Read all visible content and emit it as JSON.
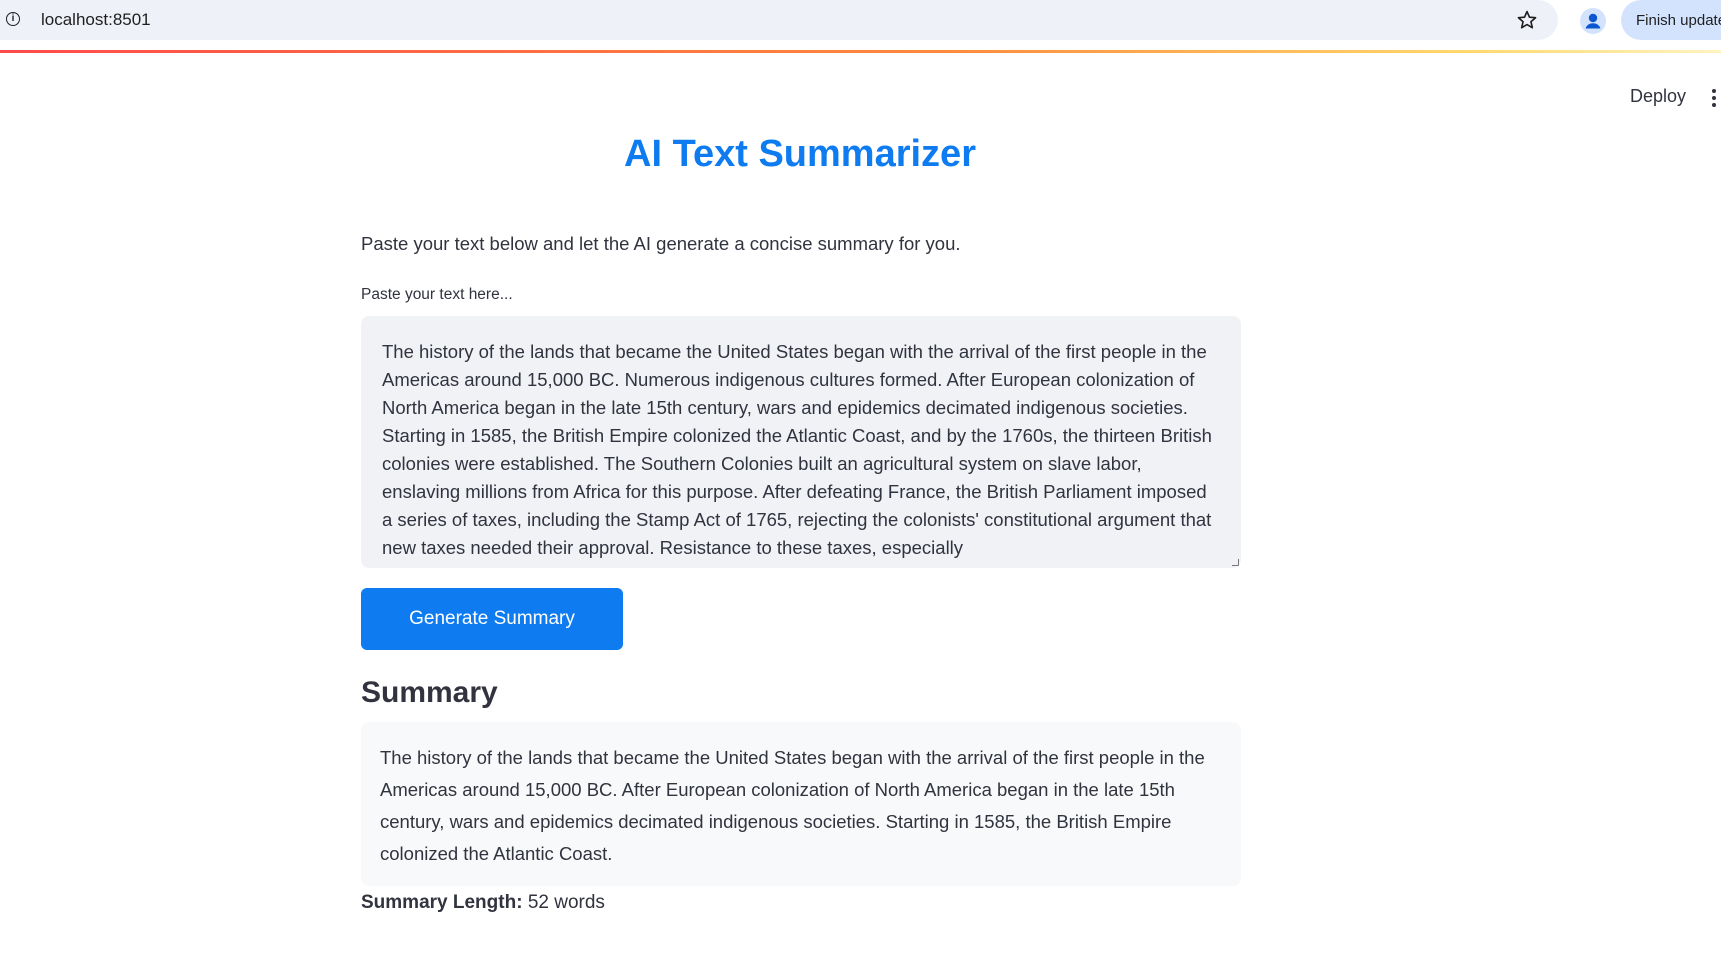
{
  "browser": {
    "url": "localhost:8501",
    "update_button": "Finish update"
  },
  "app_header": {
    "deploy_label": "Deploy"
  },
  "main": {
    "title": "AI Text Summarizer",
    "intro": "Paste your text below and let the AI generate a concise summary for you.",
    "input_label": "Paste your text here...",
    "input_value": "The history of the lands that became the United States began with the arrival of the first people in the Americas around 15,000 BC. Numerous indigenous cultures formed. After European colonization of North America began in the late 15th century, wars and epidemics decimated indigenous societies. Starting in 1585, the British Empire colonized the Atlantic Coast, and by the 1760s, the thirteen British colonies were established. The Southern Colonies built an agricultural system on slave labor, enslaving millions from Africa for this purpose. After defeating France, the British Parliament imposed a series of taxes, including the Stamp Act of 1765, rejecting the colonists' constitutional argument that new taxes needed their approval. Resistance to these taxes, especially",
    "generate_button": "Generate Summary",
    "summary_heading": "Summary",
    "summary_text": "The history of the lands that became the United States began with the arrival of the first people in the Americas around 15,000 BC. After European colonization of North America began in the late 15th century, wars and epidemics decimated indigenous societies. Starting in 1585, the British Empire colonized the Atlantic Coast.",
    "summary_length_label": "Summary Length:",
    "summary_length_value": "52 words"
  },
  "colors": {
    "accent": "#0e7cf0",
    "text": "#31333f",
    "input_bg": "#f0f2f6",
    "summary_bg": "#f8f9fb"
  },
  "icons": [
    "info-icon",
    "star-icon",
    "profile-icon",
    "kebab-menu-icon"
  ]
}
